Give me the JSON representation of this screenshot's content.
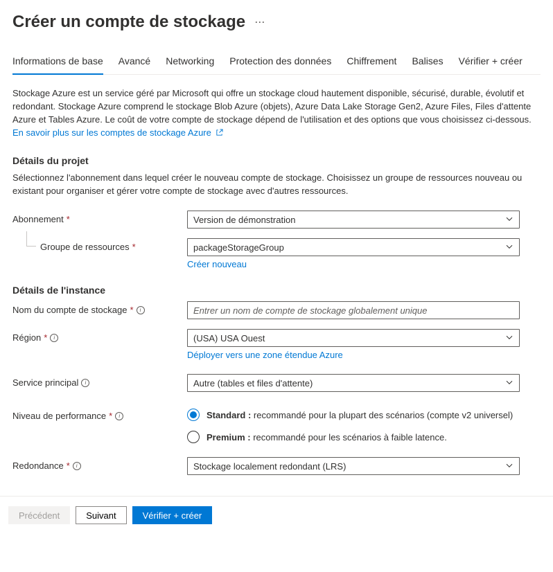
{
  "title": "Créer un compte de stockage",
  "tabs": [
    "Informations de base",
    "Avancé",
    "Networking",
    "Protection des données",
    "Chiffrement",
    "Balises",
    "Vérifier + créer"
  ],
  "activeTab": 0,
  "intro": "Stockage Azure est un service géré par Microsoft qui offre un stockage cloud hautement disponible, sécurisé, durable, évolutif et redondant. Stockage Azure comprend le stockage Blob Azure (objets), Azure Data Lake Storage Gen2, Azure Files, Files d'attente Azure et Tables Azure. Le coût de votre compte de stockage dépend de l'utilisation et des options que vous choisissez ci-dessous.",
  "introLink": "En savoir plus sur les comptes de stockage Azure",
  "project": {
    "heading": "Détails du projet",
    "desc": "Sélectionnez l'abonnement dans lequel créer le nouveau compte de stockage. Choisissez un groupe de ressources nouveau ou existant pour organiser et gérer votre compte de stockage avec d'autres ressources.",
    "subscriptionLabel": "Abonnement",
    "subscriptionValue": "Version de démonstration",
    "resourceGroupLabel": "Groupe de ressources",
    "resourceGroupValue": "packageStorageGroup",
    "createNew": "Créer nouveau"
  },
  "instance": {
    "heading": "Détails de l'instance",
    "nameLabel": "Nom du compte de stockage",
    "namePlaceholder": "Entrer un nom de compte de stockage globalement unique",
    "regionLabel": "Région",
    "regionValue": "(USA) USA Ouest",
    "regionLink": "Déployer vers une zone étendue Azure",
    "serviceLabel": "Service principal",
    "serviceValue": "Autre (tables et files d'attente)",
    "perfLabel": "Niveau de performance",
    "perfOptions": [
      {
        "bold": "Standard :",
        "rest": " recommandé pour la plupart des scénarios (compte v2 universel)",
        "checked": true
      },
      {
        "bold": "Premium :",
        "rest": " recommandé pour les scénarios à faible latence.",
        "checked": false
      }
    ],
    "redundancyLabel": "Redondance",
    "redundancyValue": "Stockage localement redondant (LRS)"
  },
  "footer": {
    "prev": "Précédent",
    "next": "Suivant",
    "review": "Vérifier + créer"
  }
}
